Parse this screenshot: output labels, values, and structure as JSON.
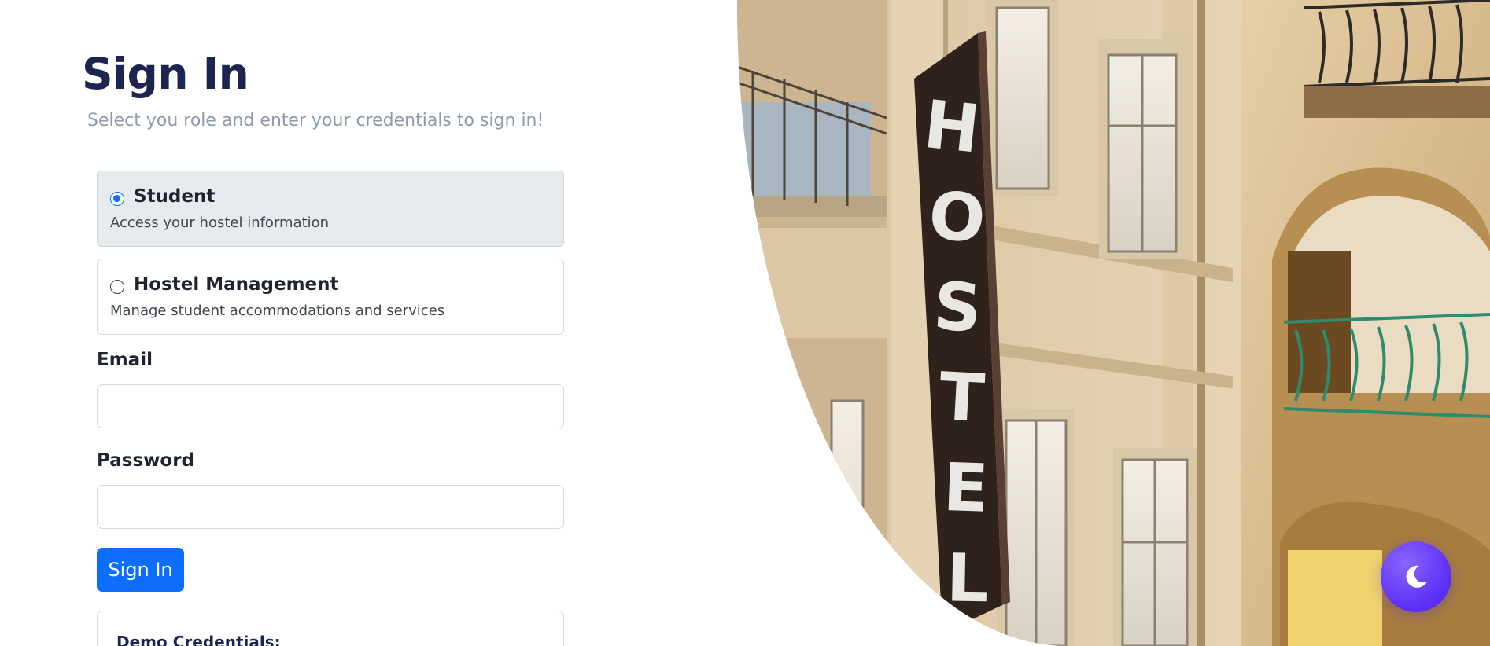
{
  "page": {
    "title": "Sign In",
    "subtitle": "Select you role and enter your credentials to sign in!"
  },
  "roles": [
    {
      "name": "Student",
      "description": "Access your hostel information",
      "selected": true
    },
    {
      "name": "Hostel Management",
      "description": "Manage student accommodations and services",
      "selected": false
    }
  ],
  "form": {
    "email_label": "Email",
    "email_value": "",
    "password_label": "Password",
    "password_value": "",
    "submit_label": "Sign In"
  },
  "demo": {
    "title": "Demo Credentials:"
  },
  "hero": {
    "sign_letters": [
      "H",
      "O",
      "S",
      "T",
      "E",
      "L"
    ]
  },
  "theme_toggle": {
    "icon": "moon-icon",
    "mode": "light"
  },
  "colors": {
    "primary": "#0d6efd",
    "heading": "#1c2550",
    "muted": "#8d9aac",
    "toggle": "#6a3ff8"
  }
}
